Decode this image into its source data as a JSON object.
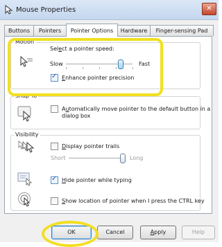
{
  "window": {
    "title": "Mouse Properties"
  },
  "tabs": [
    {
      "label": "Buttons"
    },
    {
      "label": "Pointers"
    },
    {
      "label": "Pointer Options"
    },
    {
      "label": "Hardware"
    },
    {
      "label": "Finger-sensing Pad"
    }
  ],
  "motion": {
    "legend": "Motion",
    "speed_label_pre": "Sel",
    "speed_label_key": "e",
    "speed_label_post": "ct a pointer speed:",
    "slow_label": "Slow",
    "fast_label": "Fast",
    "speed_fraction": 0.82,
    "precision": {
      "label_key": "E",
      "label_rest": "nhance pointer precision",
      "checked": true
    }
  },
  "snap_to": {
    "legend": "Snap To",
    "checkbox": {
      "label_pre": "A",
      "label_key": "u",
      "label_line1_rest": "tomatically move pointer to the default button in a",
      "label_line2": "dialog box",
      "checked": false
    }
  },
  "visibility": {
    "legend": "Visibility",
    "trails": {
      "label_key": "D",
      "label_rest": "isplay pointer trails",
      "checked": false
    },
    "trail_short": "Short",
    "trail_long": "Long",
    "trail_fraction": 1.0,
    "hide_typing": {
      "label_key": "H",
      "label_rest": "ide pointer while typing",
      "checked": true
    },
    "show_ctrl": {
      "label_key": "S",
      "label_rest": "how location of pointer when I press the CTRL key",
      "checked": false
    }
  },
  "buttons": {
    "ok": "OK",
    "cancel": "Cancel",
    "apply_key": "A",
    "apply_rest": "pply",
    "help": "Help"
  },
  "colors": {
    "highlight": "#f2df1f",
    "accent": "#3c7fb1"
  }
}
